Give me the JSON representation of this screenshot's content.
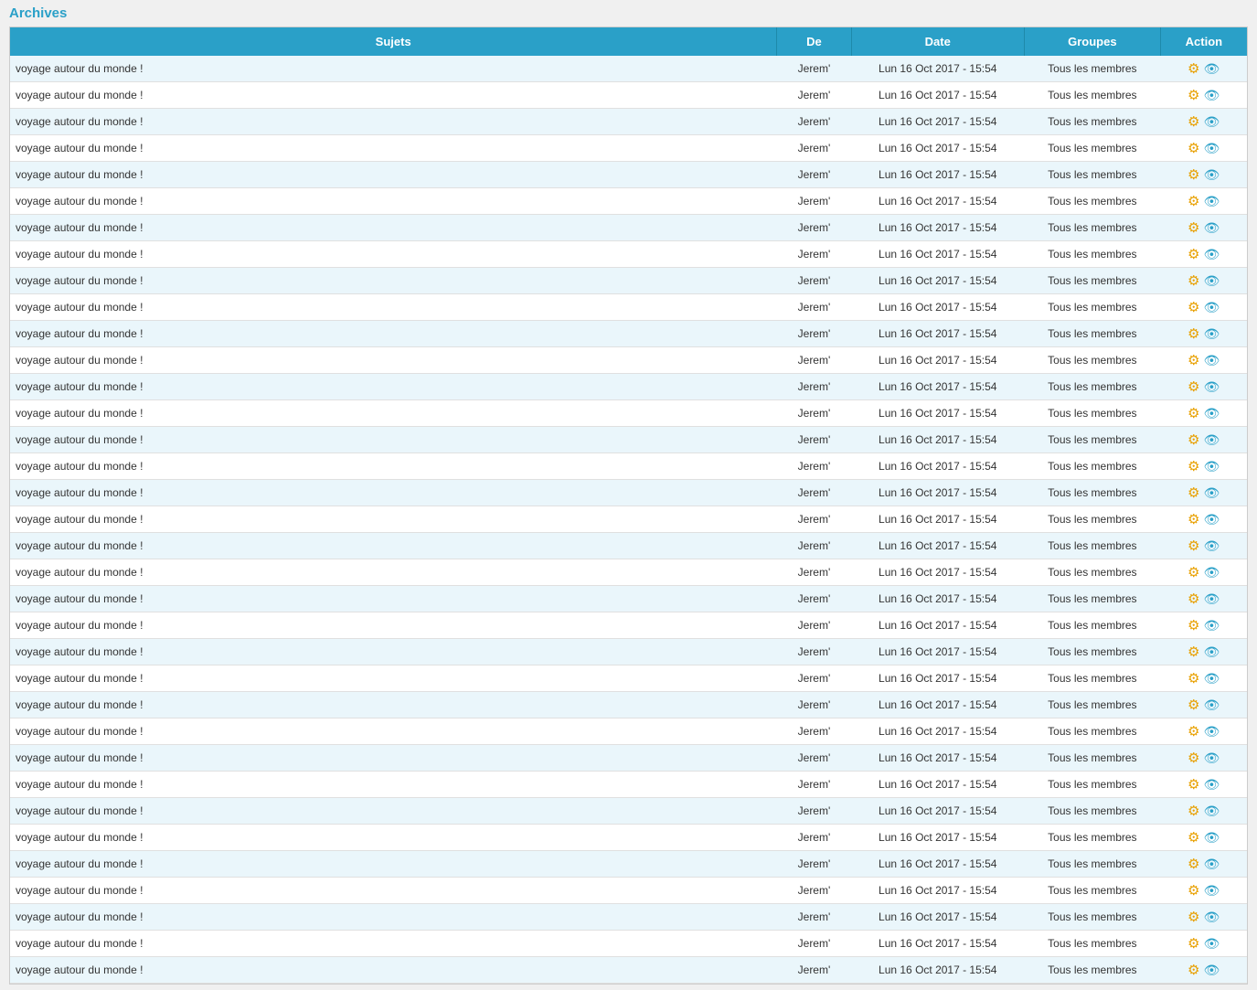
{
  "title": "Archives",
  "table": {
    "headers": {
      "sujets": "Sujets",
      "de": "De",
      "date": "Date",
      "groupes": "Groupes",
      "action": "Action"
    },
    "row_subject": "voyage autour du monde !",
    "row_de": "Jerem'",
    "row_date": "Lun 16 Oct 2017 - 15:54",
    "row_groupes": "Tous les membres",
    "row_count": 35
  },
  "icons": {
    "gear": "⚙",
    "eye": "👁"
  }
}
